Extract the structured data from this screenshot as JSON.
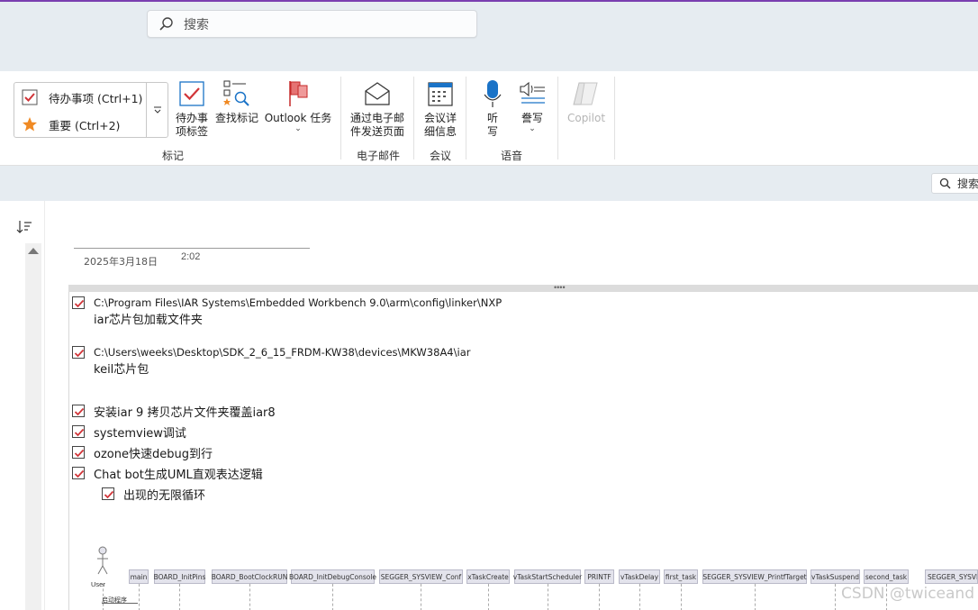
{
  "titlebar": {
    "search_placeholder": "搜索"
  },
  "ribbon": {
    "gallery": {
      "items": [
        {
          "label": "待办事项 (Ctrl+1)",
          "icon": "checkbox-icon"
        },
        {
          "label": "重要 (Ctrl+2)",
          "icon": "star-icon"
        }
      ]
    },
    "buttons": {
      "todo_tag": "待办事\n项标签",
      "find_tags": "查找标记",
      "outlook_tasks": "Outlook 任务",
      "email_page": "通过电子邮\n件发送页面",
      "meeting_details": "会议详\n细信息",
      "dictate": "听\n写",
      "transcribe": "誊写",
      "copilot": "Copilot"
    },
    "groups": {
      "tags": "标记",
      "email": "电子邮件",
      "meetings": "会议",
      "voice": "语音"
    }
  },
  "subbar": {
    "search_label": "搜索"
  },
  "note": {
    "date": "2025年3月18日",
    "time": "2:02",
    "todos": [
      {
        "line1": "C:\\Program Files\\IAR Systems\\Embedded Workbench 9.0\\arm\\config\\linker\\NXP",
        "line2": "iar芯片包加载文件夹"
      },
      {
        "line1": "C:\\Users\\weeks\\Desktop\\SDK_2_6_15_FRDM-KW38\\devices\\MKW38A4\\iar",
        "line2": "keil芯片包"
      },
      {
        "text": "安装iar 9 拷贝芯片文件夹覆盖iar8"
      },
      {
        "text": "systemview调试"
      },
      {
        "text": "ozone快速debug到行"
      },
      {
        "text": "Chat bot生成UML直观表达逻辑"
      },
      {
        "text": "出现的无限循环"
      }
    ]
  },
  "diagram": {
    "actor": "User",
    "lifelines": [
      "main",
      "BOARD_InitPins",
      "BOARD_BootClockRUN",
      "BOARD_InitDebugConsole",
      "SEGGER_SYSVIEW_Conf",
      "xTaskCreate",
      "vTaskStartScheduler",
      "PRINTF",
      "vTaskDelay",
      "first_task",
      "SEGGER_SYSVIEW_PrintfTarget",
      "vTaskSuspend",
      "second_task",
      "SEGGER_SYSVIEW"
    ],
    "message": "启动程序"
  },
  "watermark": "CSDN @twiceand",
  "colors": {
    "accent": "#7a3fb0",
    "check_red": "#d13438",
    "star_orange": "#f08a24",
    "chrome_bg": "#e6ecf1"
  }
}
